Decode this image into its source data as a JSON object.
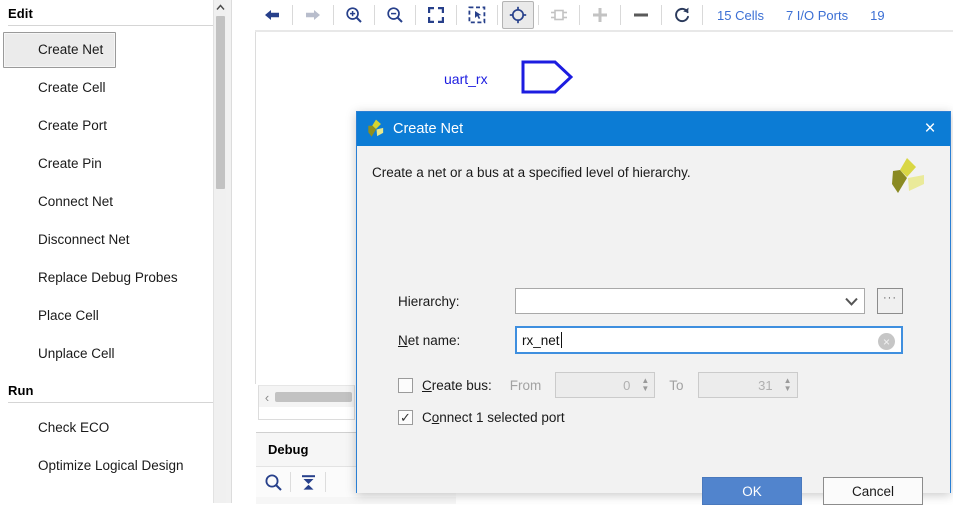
{
  "sidebar": {
    "groups": [
      {
        "title": "Edit",
        "items": [
          {
            "label": "Create Net",
            "selected": true
          },
          {
            "label": "Create Cell",
            "selected": false
          },
          {
            "label": "Create Port",
            "selected": false
          },
          {
            "label": "Create Pin",
            "selected": false
          },
          {
            "label": "Connect Net",
            "selected": false
          },
          {
            "label": "Disconnect Net",
            "selected": false
          },
          {
            "label": "Replace Debug Probes",
            "selected": false
          },
          {
            "label": "Place Cell",
            "selected": false
          },
          {
            "label": "Unplace Cell",
            "selected": false
          }
        ]
      },
      {
        "title": "Run",
        "items": [
          {
            "label": "Check ECO",
            "selected": false
          },
          {
            "label": "Optimize Logical Design",
            "selected": false
          }
        ]
      }
    ]
  },
  "toolbar": {
    "buttons": [
      {
        "name": "back-arrow-icon",
        "glyph": "←",
        "active": false,
        "enabled": true
      },
      {
        "name": "forward-arrow-icon",
        "glyph": "→",
        "active": false,
        "enabled": false
      },
      {
        "name": "zoom-in-icon",
        "glyph": "zoom-in",
        "active": false,
        "enabled": true
      },
      {
        "name": "zoom-out-icon",
        "glyph": "zoom-out",
        "active": false,
        "enabled": true
      },
      {
        "name": "zoom-fit-icon",
        "glyph": "fit",
        "active": false,
        "enabled": true
      },
      {
        "name": "zoom-area-icon",
        "glyph": "area",
        "active": false,
        "enabled": true
      },
      {
        "name": "crosshair-target-icon",
        "glyph": "target",
        "active": true,
        "enabled": true
      },
      {
        "name": "chip-icon",
        "glyph": "chip",
        "active": false,
        "enabled": false
      },
      {
        "name": "plus-icon",
        "glyph": "+",
        "active": false,
        "enabled": false
      },
      {
        "name": "minus-icon",
        "glyph": "−",
        "active": false,
        "enabled": true
      },
      {
        "name": "refresh-icon",
        "glyph": "refresh",
        "active": false,
        "enabled": true
      }
    ],
    "stats": [
      "15 Cells",
      "7 I/O Ports",
      "19"
    ]
  },
  "canvas": {
    "port_label": "uart_rx"
  },
  "debug_panel": {
    "title": "Debug",
    "tools": [
      "search-icon",
      "collapse-icon"
    ]
  },
  "dialog": {
    "title": "Create Net",
    "close_label": "×",
    "description": "Create a net or a bus at a specified level of hierarchy.",
    "hierarchy": {
      "label": "Hierarchy:",
      "value": "",
      "placeholder": "",
      "browse_label": "···"
    },
    "net_name": {
      "label_prefix": "",
      "label_mnemonic": "N",
      "label_suffix": "et name:",
      "value": "rx_net",
      "clear_label": "×"
    },
    "create_bus": {
      "checked": false,
      "label_prefix": "",
      "label_mnemonic": "C",
      "label_suffix": "reate bus:",
      "from_label": "From",
      "from_value": "0",
      "to_label": "To",
      "to_value": "31"
    },
    "connect_port": {
      "checked": true,
      "label_prefix": "C",
      "label_mnemonic": "o",
      "label_suffix": "nnect 1 selected  port"
    },
    "ok_label": "OK",
    "cancel_label": "Cancel"
  },
  "colors": {
    "title_bar": "#0c7cd5",
    "accent_button": "#5184cd",
    "link_text": "#3b6fd4",
    "net_blue": "#1c1ce0",
    "focus_border": "#3f8fdf"
  }
}
